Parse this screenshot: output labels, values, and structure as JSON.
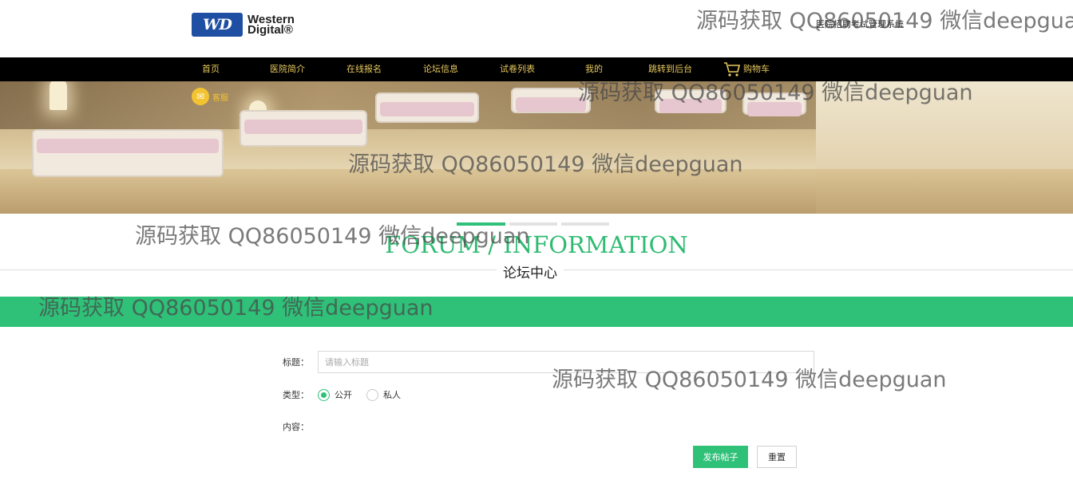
{
  "header": {
    "logo_mark": "WD",
    "logo_text_line1": "Western",
    "logo_text_line2": "Digital®",
    "site_title": "医院招聘考试管理系统"
  },
  "nav": {
    "items": [
      {
        "label": "首页"
      },
      {
        "label": "医院简介"
      },
      {
        "label": "在线报名"
      },
      {
        "label": "论坛信息"
      },
      {
        "label": "试卷列表"
      },
      {
        "label": "我的"
      },
      {
        "label": "跳转到后台"
      },
      {
        "label": "购物车"
      }
    ]
  },
  "banner": {
    "chat_label": "客服"
  },
  "section": {
    "title_en": "FORUM / INFORMATION",
    "title_cn": "论坛中心"
  },
  "form": {
    "title_label": "标题：",
    "title_placeholder": "请输入标题",
    "type_label": "类型：",
    "type_options": [
      {
        "label": "公开",
        "selected": true
      },
      {
        "label": "私人",
        "selected": false
      }
    ],
    "content_label": "内容：",
    "submit_label": "发布帖子",
    "reset_label": "重置"
  },
  "watermark": {
    "text": "源码获取 QQ86050149 微信deepguan"
  },
  "colors": {
    "accent": "#30c179",
    "nav_bg": "#000000",
    "nav_text": "#e8c95e"
  }
}
